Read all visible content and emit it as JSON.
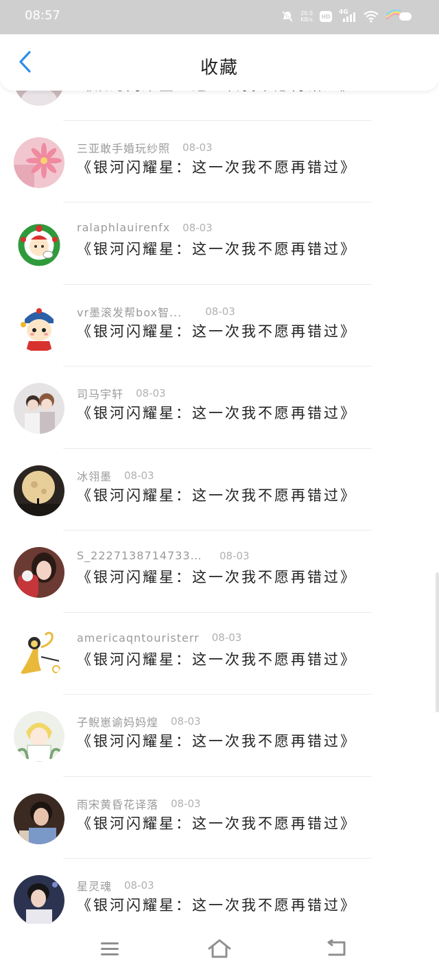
{
  "status_bar": {
    "time": "08:57",
    "net_speed_value": "20.0",
    "net_speed_unit": "KB/s",
    "hd_label": "HD",
    "network_label": "4G",
    "icons": [
      "mute-icon",
      "hd-icon",
      "signal-icon",
      "wifi-icon",
      "battery-icon"
    ]
  },
  "header": {
    "title": "收藏",
    "back_icon": "chevron-left-icon",
    "accent_color": "#2f8ee8"
  },
  "list": {
    "items": [
      {
        "username": "",
        "date": "",
        "title": "《银河闪耀星：这一次我不愿再错过》",
        "avatar": "avatar-partial"
      },
      {
        "username": "三亚敢手婚玩纱照",
        "date": "08-03",
        "title": "《银河闪耀星：这一次我不愿再错过》",
        "avatar": "pink-flower"
      },
      {
        "username": "ralaphlauirenfx",
        "date": "08-03",
        "title": "《银河闪耀星：这一次我不愿再错过》",
        "avatar": "wreath-character"
      },
      {
        "username": "vr墨滚发帮box智...",
        "date": "08-03",
        "title": "《银河闪耀星：这一次我不愿再错过》",
        "avatar": "cartoon-kid"
      },
      {
        "username": "司马宇轩",
        "date": "08-03",
        "title": "《银河闪耀星：这一次我不愿再错过》",
        "avatar": "couple-photo"
      },
      {
        "username": "冰翎墨",
        "date": "08-03",
        "title": "《银河闪耀星：这一次我不愿再错过》",
        "avatar": "moon-night"
      },
      {
        "username": "S_22271387147337...",
        "date": "08-03",
        "title": "《银河闪耀星：这一次我不愿再错过》",
        "avatar": "girl-portrait"
      },
      {
        "username": "americaqntouristerr",
        "date": "08-03",
        "title": "《银河闪耀星：这一次我不愿再错过》",
        "avatar": "yellow-creature"
      },
      {
        "username": "子鲵崽谕妈妈煌",
        "date": "08-03",
        "title": "《银河闪耀星：这一次我不愿再错过》",
        "avatar": "blond-anime"
      },
      {
        "username": "雨宋黄昏花译落",
        "date": "08-03",
        "title": "《银河闪耀星：这一次我不愿再错过》",
        "avatar": "boy-portrait"
      },
      {
        "username": "星灵魂",
        "date": "08-03",
        "title": "《银河闪耀星：这一次我不愿再错过》",
        "avatar": "singer-portrait"
      }
    ]
  },
  "nav_bar": {
    "icons": [
      "menu-icon",
      "home-icon",
      "back-icon"
    ]
  }
}
